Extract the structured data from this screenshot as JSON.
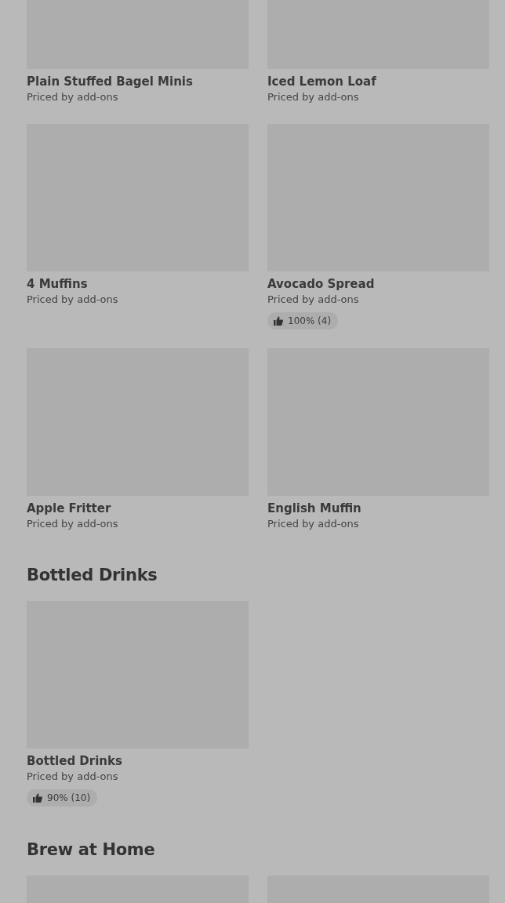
{
  "sections": [
    {
      "items": [
        {
          "kind": "card",
          "name": "Plain Stuffed Bagel Minis",
          "price_note": "Priced by add-ons"
        },
        {
          "kind": "card",
          "name": "Iced Lemon Loaf",
          "price_note": "Priced by add-ons"
        },
        {
          "kind": "card",
          "name": "4 Muffins",
          "price_note": "Priced by add-ons"
        },
        {
          "kind": "card",
          "name": "Avocado Spread",
          "price_note": "Priced by add-ons",
          "rating": "100% (4)"
        },
        {
          "kind": "card",
          "name": "Apple Fritter",
          "price_note": "Priced by add-ons"
        },
        {
          "kind": "card",
          "name": "English Muffin",
          "price_note": "Priced by add-ons"
        }
      ]
    },
    {
      "heading": "Bottled Drinks",
      "items": [
        {
          "kind": "card",
          "name": "Bottled Drinks",
          "price_note": "Priced by add-ons",
          "rating": "90% (10)"
        }
      ]
    },
    {
      "heading": "Brew at Home"
    }
  ]
}
